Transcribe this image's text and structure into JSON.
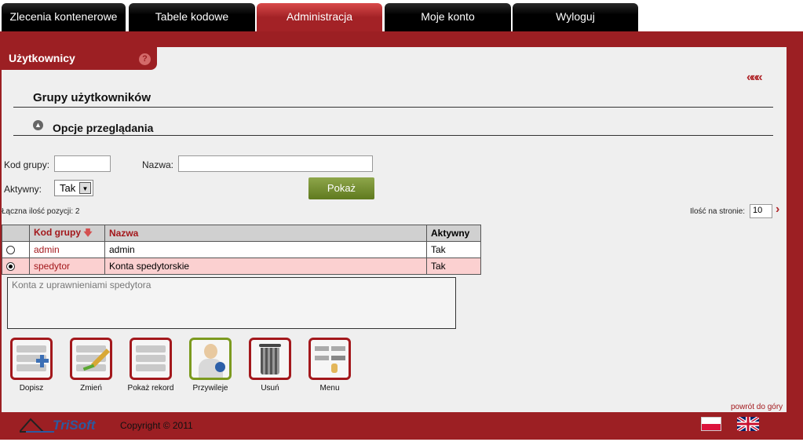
{
  "tabs": [
    {
      "label": "Zlecenia kontenerowe"
    },
    {
      "label": "Tabele kodowe"
    },
    {
      "label": "Administracja",
      "active": true
    },
    {
      "label": "Moje konto"
    },
    {
      "label": "Wyloguj"
    }
  ],
  "section": {
    "title": "Użytkownicy",
    "help_icon": "question-icon"
  },
  "back_label": "«««",
  "page_title": "Grupy użytkowników",
  "options_title": "Opcje przeglądania",
  "filters": {
    "code_label": "Kod grupy:",
    "code_value": "",
    "name_label": "Nazwa:",
    "name_value": "",
    "active_label": "Aktywny:",
    "active_value": "Tak",
    "show_button": "Pokaż"
  },
  "total": "Łączna ilość pozycji: 2",
  "per_page_label": "Ilość na stronie:",
  "per_page_value": "10",
  "table": {
    "headers": [
      "Kod grupy",
      "Nazwa",
      "Aktywny"
    ],
    "sort_icon": "arrow-down-icon",
    "rows": [
      {
        "code": "admin",
        "name": "admin",
        "active": "Tak",
        "selected": false
      },
      {
        "code": "spedytor",
        "name": "Konta spedytorskie",
        "active": "Tak",
        "selected": true
      }
    ]
  },
  "description": "Konta z uprawnieniami spedytora",
  "actions": [
    {
      "label": "Dopisz",
      "icon": "add-record-icon"
    },
    {
      "label": "Zmień",
      "icon": "edit-icon"
    },
    {
      "label": "Pokaż rekord",
      "icon": "view-record-icon"
    },
    {
      "label": "Przywileje",
      "icon": "privileges-icon"
    },
    {
      "label": "Usuń",
      "icon": "trash-icon"
    },
    {
      "label": "Menu",
      "icon": "menu-icon"
    }
  ],
  "footer": {
    "back_to_top": "powrót do góry",
    "logo": "TriSoft",
    "copyright": "Copyright © 2011",
    "flags": [
      "flag-pl-icon",
      "flag-en-icon"
    ]
  },
  "colors": {
    "brand": "#9c1f23",
    "accent_green": "#6c8a25",
    "selected_row": "#fbd0d0"
  }
}
